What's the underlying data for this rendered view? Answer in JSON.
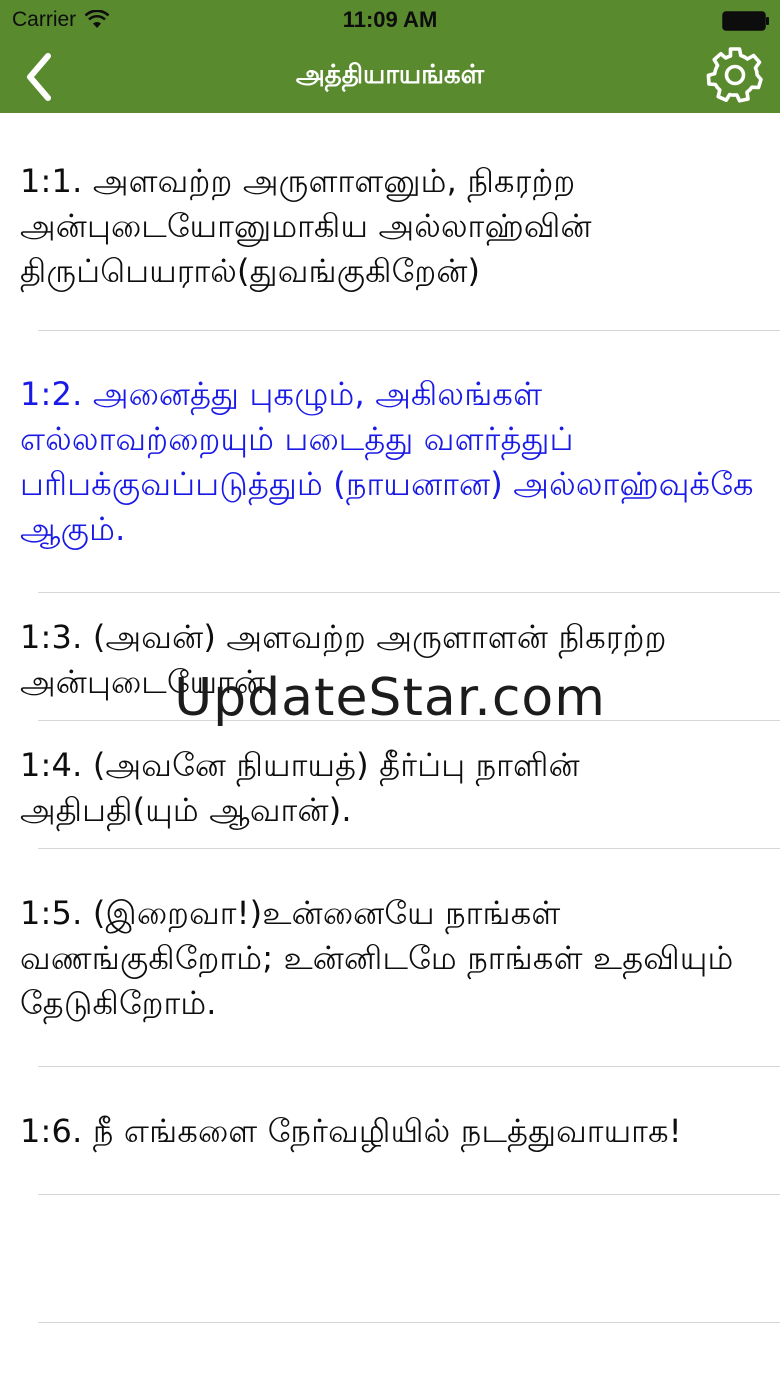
{
  "status_bar": {
    "carrier": "Carrier",
    "time": "11:09 AM",
    "wifi_icon": "wifi-icon",
    "battery_icon": "battery-icon"
  },
  "nav": {
    "title": "அத்தியாயங்கள்",
    "back_icon": "chevron-left-icon",
    "settings_icon": "gear-icon",
    "bar_color": "#5a8a2e"
  },
  "verses": [
    {
      "text": "1:1. அளவற்ற அருளாளனும், நிகரற்ற அன்புடையோனுமாகிய அல்லாஹ்வின் திருப்பெயரால்(துவங்குகிறேன்)"
    },
    {
      "text": "1:2. அனைத்து புகழும், அகிலங்கள் எல்லாவற்றையும் படைத்து வளர்த்துப் பரிபக்குவப்படுத்தும் (நாயனான) அல்லாஹ்வுக்கே ஆகும்.",
      "selected": true
    },
    {
      "text": "1:3. (அவன்) அளவற்ற அருளாளன் நிகரற்ற அன்புடையோன்."
    },
    {
      "text": "1:4. (அவனே நியாயத்) தீர்ப்பு நாளின் அதிபதி(யும் ஆவான்)."
    },
    {
      "text": "1:5. (இறைவா!)உன்னையே நாங்கள் வணங்குகிறோம்; உன்னிடமே நாங்கள் உதவியும் தேடுகிறோம்."
    },
    {
      "text": "1:6. நீ எங்களை நேர்வழியில் நடத்துவாயாக!"
    },
    {
      "text": ""
    }
  ],
  "selected_color": "#1a1ae6",
  "watermark": "UpdateStar.com"
}
